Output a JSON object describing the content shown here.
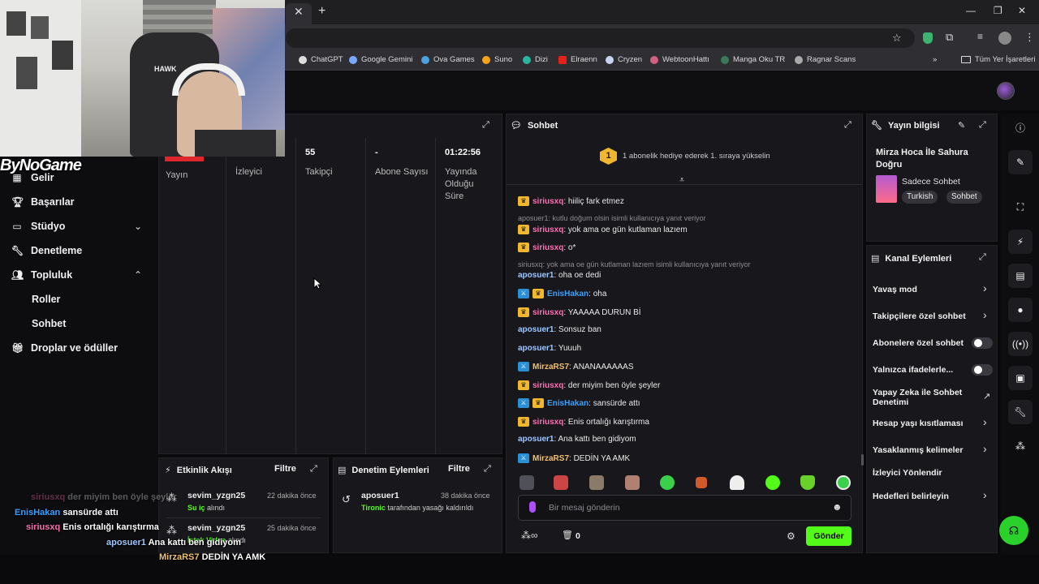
{
  "bookmarks": [
    "ChatGPT",
    "Google Gemini",
    "Ova Games",
    "Suno",
    "Dizi",
    "Elraenn",
    "Cryzen",
    "WebtoonHattı",
    "Manga Oku TR",
    "Ragnar Scans",
    "Tüm Yer İşaretleri"
  ],
  "stream_overlay": {
    "logo": "ByNoGame",
    "chair_brand": "HAWK"
  },
  "sidebar": {
    "items": [
      {
        "label": "Gelir",
        "icon": "income-icon"
      },
      {
        "label": "Başarılar",
        "icon": "trophy-icon"
      },
      {
        "label": "Stüdyo",
        "icon": "studio-icon"
      },
      {
        "label": "Denetleme",
        "icon": "wrench-icon"
      },
      {
        "label": "Topluluk",
        "icon": "community-icon"
      },
      {
        "label": "Roller",
        "icon": ""
      },
      {
        "label": "Sohbet",
        "icon": ""
      },
      {
        "label": "Droplar ve ödüller",
        "icon": "gift-icon"
      }
    ]
  },
  "stats": [
    {
      "value": "",
      "label": "Yayın"
    },
    {
      "value": "",
      "label": "İzleyici"
    },
    {
      "value": "55",
      "label": "Takipçi"
    },
    {
      "value": "-",
      "label": "Abone Sayısı"
    },
    {
      "value": "01:22:56",
      "label": "Yayında Olduğu Süre"
    }
  ],
  "activity_feed": {
    "title": "Etkinlik Akışı",
    "filter": "Filtre",
    "items": [
      {
        "user": "sevim_yzgn25",
        "time": "22 dakika önce",
        "reward": "Su iç",
        "suffix": "alındı"
      },
      {
        "user": "sevim_yzgn25",
        "time": "25 dakika önce",
        "reward": "İstek Video",
        "suffix": "alındı"
      }
    ]
  },
  "mod_actions": {
    "title": "Denetim Eylemleri",
    "filter": "Filtre",
    "items": [
      {
        "user": "aposuer1",
        "time": "38 dakika önce",
        "actor": "Tironic",
        "text": "tarafından yasağı kaldırıldı"
      }
    ]
  },
  "chat": {
    "title": "Sohbet",
    "pinned_count": "1",
    "pinned_text": "1 abonelik hediye ederek 1. sıraya yükselin",
    "messages": [
      {
        "type": "msg",
        "badges": [
          "crown"
        ],
        "user": "siriusxq",
        "color": "#ff6eb4",
        "text": ": hiiliç fark etmez"
      },
      {
        "type": "reply",
        "text": "aposuer1: kutlu doğum olsin isimli kullanıcıya yanıt veriyor"
      },
      {
        "type": "msg",
        "badges": [
          "crown"
        ],
        "user": "siriusxq",
        "color": "#ff6eb4",
        "text": ": yok ama oe gün kutlaman lazıem"
      },
      {
        "type": "msg",
        "badges": [
          "crown"
        ],
        "user": "siriusxq",
        "color": "#ff6eb4",
        "text": ": o*"
      },
      {
        "type": "reply",
        "text": "siriusxq: yok ama oe gün kutlaman lazıem isimli kullanıcıya yanıt veriyor"
      },
      {
        "type": "msg",
        "badges": [],
        "user": "aposuer1",
        "color": "#9fc7ff",
        "text": ": oha oe dedi"
      },
      {
        "type": "msg",
        "badges": [
          "mod",
          "crown"
        ],
        "user": "EnisHakan",
        "color": "#3aa0ff",
        "text": ": oha"
      },
      {
        "type": "msg",
        "badges": [
          "crown"
        ],
        "user": "siriusxq",
        "color": "#ff6eb4",
        "text": ": YAAAAA DURUN Bİ"
      },
      {
        "type": "msg",
        "badges": [],
        "user": "aposuer1",
        "color": "#9fc7ff",
        "text": ": Sonsuz ban"
      },
      {
        "type": "msg",
        "badges": [],
        "user": "aposuer1",
        "color": "#9fc7ff",
        "text": ": Yuuuh"
      },
      {
        "type": "msg",
        "badges": [
          "mod"
        ],
        "user": "MirzaRS7",
        "color": "#f0c070",
        "text": ": ANANAAAAAAS"
      },
      {
        "type": "msg",
        "badges": [
          "crown"
        ],
        "user": "siriusxq",
        "color": "#ff6eb4",
        "text": ": der miyim ben öyle şeyler"
      },
      {
        "type": "msg",
        "badges": [
          "mod",
          "crown"
        ],
        "user": "EnisHakan",
        "color": "#3aa0ff",
        "text": ": sansürde attı"
      },
      {
        "type": "msg",
        "badges": [
          "crown"
        ],
        "user": "siriusxq",
        "color": "#ff6eb4",
        "text": ": Enis ortalığı karıştırma"
      },
      {
        "type": "msg",
        "badges": [],
        "user": "aposuer1",
        "color": "#9fc7ff",
        "text": ": Ana kattı ben gidiyom"
      },
      {
        "type": "msg",
        "badges": [
          "mod"
        ],
        "user": "MirzaRS7",
        "color": "#f0c070",
        "text": ": DEDİN YA AMK"
      }
    ],
    "input_placeholder": "Bir mesaj gönderin",
    "send_label": "Gönder",
    "points": "0"
  },
  "stream_info": {
    "title": "Yayın bilgisi",
    "stream_title": "Mirza Hoca İle Sahura Doğru",
    "category": "Sadece Sohbet",
    "tags": [
      "Turkish",
      "Sohbet"
    ]
  },
  "channel_actions": {
    "title": "Kanal Eylemleri",
    "items": [
      {
        "label": "Yavaş mod",
        "control": "arrow"
      },
      {
        "label": "Takipçilere özel sohbet",
        "control": "arrow"
      },
      {
        "label": "Abonelere özel sohbet",
        "control": "toggle"
      },
      {
        "label": "Yalnızca ifadelerle...",
        "control": "toggle"
      },
      {
        "label": "Yapay Zeka ile Sohbet Denetimi",
        "control": "external"
      },
      {
        "label": "Hesap yaşı kısıtlaması",
        "control": "arrow"
      },
      {
        "label": "Yasaklanmış kelimeler",
        "control": "arrow"
      },
      {
        "label": "İzleyici Yönlendir",
        "control": "none"
      },
      {
        "label": "Hedefleri belirleyin",
        "control": "arrow"
      }
    ]
  },
  "overlay_chat": [
    {
      "user": "siriusxq",
      "text": "der miyim ben öyle şeyler",
      "color": "#ff6eb4"
    },
    {
      "user": "EnisHakan",
      "text": "sansürde attı",
      "color": "#3aa0ff"
    },
    {
      "user": "siriusxq",
      "text": "Enis ortalığı karıştırma",
      "color": "#ff6eb4"
    },
    {
      "user": "aposuer1",
      "text": "Ana kattı ben gidiyom",
      "color": "#9fc7ff"
    },
    {
      "user": "MirzaRS7",
      "text": "DEDİN YA AMK",
      "color": "#f0c070"
    }
  ],
  "colors": {
    "accent": "#53fc18",
    "gold": "#f0b72f",
    "panel": "#18181c"
  }
}
